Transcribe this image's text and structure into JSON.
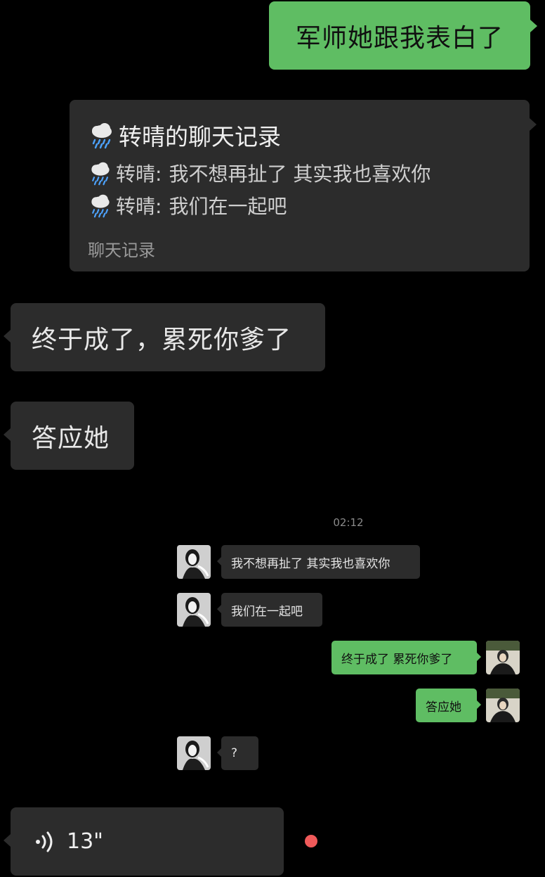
{
  "messages": {
    "outgoing_1": "军师她跟我表白了",
    "record_card": {
      "title": "转晴的聊天记录",
      "lines": [
        {
          "sender": "转晴:",
          "text": "我不想再扯了 其实我也喜欢你"
        },
        {
          "sender": "转晴:",
          "text": "我们在一起吧"
        }
      ],
      "footer": "聊天记录",
      "icon": "rain-cloud-icon"
    },
    "incoming_1": "终于成了，累死你爹了",
    "incoming_2": "答应她"
  },
  "embedded_screenshot": {
    "timestamp": "02:12",
    "messages": [
      {
        "side": "left",
        "text": "我不想再扯了 其实我也喜欢你"
      },
      {
        "side": "left",
        "text": "我们在一起吧"
      },
      {
        "side": "right",
        "text": "终于成了 累死你爹了"
      },
      {
        "side": "right",
        "text": "答应她"
      },
      {
        "side": "left",
        "text": "?"
      }
    ]
  },
  "voice_message": {
    "duration": "13\"",
    "icon": "voice-wave-icon",
    "unread_dot_color": "#f05a5a"
  },
  "colors": {
    "background": "#000000",
    "green_bubble": "#5fbd63",
    "dark_bubble": "#2c2c2c"
  }
}
